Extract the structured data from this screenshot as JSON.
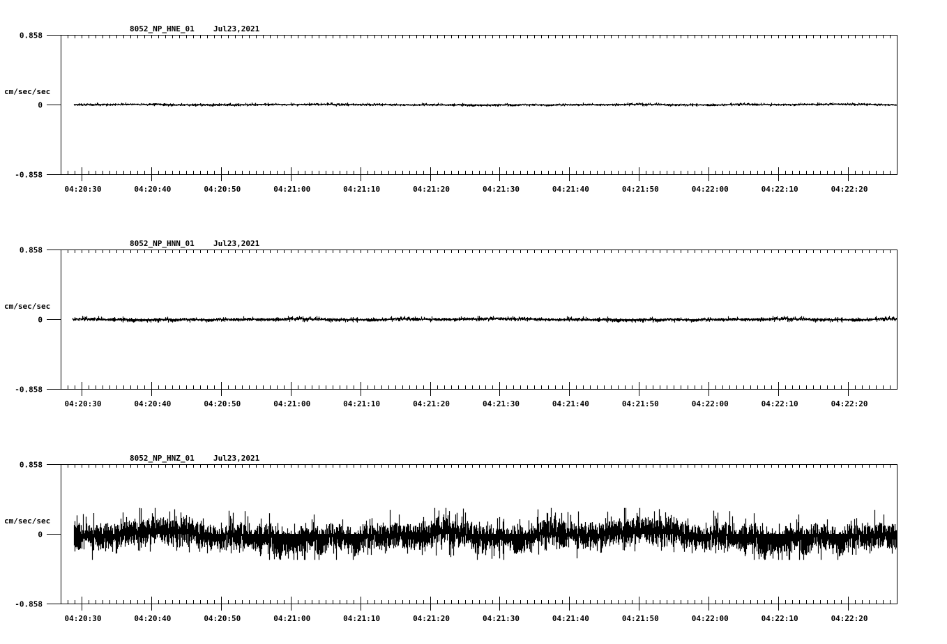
{
  "chart_data": [
    {
      "type": "line",
      "title": "8052_NP_HNE_01",
      "date": "Jul23,2021",
      "ylabel": "cm/sec/sec",
      "ylim": [
        -0.858,
        0.858
      ],
      "ytick_labels": [
        "0.858",
        "0",
        "-0.858"
      ],
      "xlim_seconds": [
        0,
        120
      ],
      "xlim_time": [
        "04:20:27",
        "04:22:27"
      ],
      "xtick_labels": [
        "04:20:30",
        "04:20:40",
        "04:20:50",
        "04:21:00",
        "04:21:10",
        "04:21:20",
        "04:21:30",
        "04:21:40",
        "04:21:50",
        "04:22:00",
        "04:22:10",
        "04:22:20"
      ],
      "signal_start_seconds": 1.9,
      "noise_amplitude": 0.012,
      "peak_amplitude": 0.025
    },
    {
      "type": "line",
      "title": "8052_NP_HNN_01",
      "date": "Jul23,2021",
      "ylabel": "cm/sec/sec",
      "ylim": [
        -0.858,
        0.858
      ],
      "ytick_labels": [
        "0.858",
        "0",
        "-0.858"
      ],
      "xlim_seconds": [
        0,
        120
      ],
      "xlim_time": [
        "04:20:27",
        "04:22:27"
      ],
      "xtick_labels": [
        "04:20:30",
        "04:20:40",
        "04:20:50",
        "04:21:00",
        "04:21:10",
        "04:21:20",
        "04:21:30",
        "04:21:40",
        "04:21:50",
        "04:22:00",
        "04:22:10",
        "04:22:20"
      ],
      "signal_start_seconds": 1.7,
      "noise_amplitude": 0.018,
      "peak_amplitude": 0.04
    },
    {
      "type": "line",
      "title": "8052_NP_HNZ_01",
      "date": "Jul23,2021",
      "ylabel": "cm/sec/sec",
      "ylim": [
        -0.858,
        0.858
      ],
      "ytick_labels": [
        "0.858",
        "0",
        "-0.858"
      ],
      "xlim_seconds": [
        0,
        120
      ],
      "xlim_time": [
        "04:20:27",
        "04:22:27"
      ],
      "xtick_labels": [
        "04:20:30",
        "04:20:40",
        "04:20:50",
        "04:21:00",
        "04:21:10",
        "04:21:20",
        "04:21:30",
        "04:21:40",
        "04:21:50",
        "04:22:00",
        "04:22:10",
        "04:22:20"
      ],
      "signal_start_seconds": 1.9,
      "noise_amplitude": 0.15,
      "peak_amplitude": 0.32
    }
  ]
}
